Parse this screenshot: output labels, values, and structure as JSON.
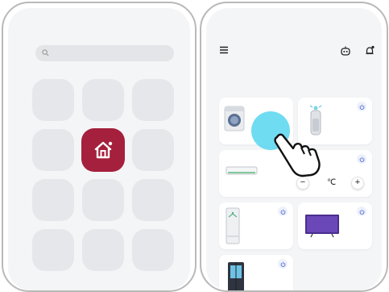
{
  "launcher": {
    "search_icon": "search-icon",
    "app_icon": "home-app-icon",
    "app_color": "#a5203c"
  },
  "app": {
    "menu_icon": "hamburger-menu-icon",
    "robot_icon": "robot-icon",
    "bell_icon": "notification-bell-icon",
    "thermostat": {
      "decrease_label": "−",
      "unit_label": "℃",
      "increase_label": "+"
    },
    "accent": "#5fd8f1"
  }
}
